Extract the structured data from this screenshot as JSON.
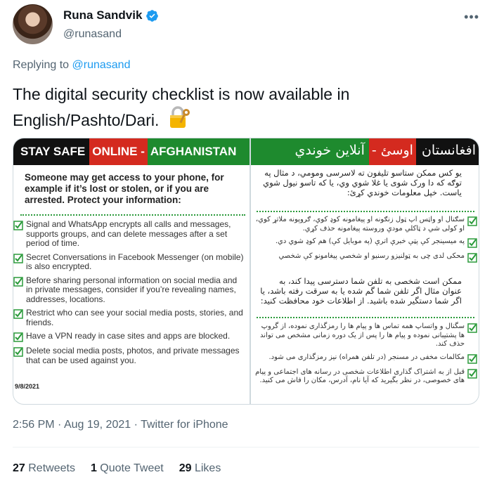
{
  "author": {
    "name": "Runa Sandvik",
    "handle": "@runasand"
  },
  "reply": {
    "prefix": "Replying to ",
    "mention": "@runasand"
  },
  "tweet": {
    "text": "The digital security checklist is now available in English/Pashto/Dari.",
    "emoji_icon": "locked-with-key-icon"
  },
  "media": {
    "left": {
      "banner_part1": "STAY SAFE ",
      "banner_part2": "ONLINE - ",
      "banner_part3": "AFGHANISTAN",
      "intro": "Someone may get access to your phone, for example if it’s lost or stolen, or if you are arrested. Protect your information:",
      "items": [
        "Signal and WhatsApp encrypts all calls and messages, supports groups, and can delete messages after a set period of time.",
        "Secret Conversations in Facebook Messenger (on mobile) is also encrypted.",
        "Before sharing personal information on social media and in private messages, consider if you’re revealing names, addresses, locations.",
        "Restrict who can see your social media posts, stories, and friends.",
        "Have a VPN ready in case sites and apps are blocked.",
        "Delete social media posts, photos, and private messages that can be used against you."
      ],
      "date": "9/8/2021"
    },
    "right": {
      "banner_part1": "آنلاین خوندي",
      "banner_part2": " اوسئ - ",
      "banner_part3": "افغانستان",
      "intro": "یو کس ممکن ستاسو تلیفون ته لاسرسی ومومي، د مثال په توګه که دا ورک شوی یا غلا شوي وي، یا که تاسو نیول شوي یاست. خپل معلومات خوندي کړئ:",
      "items": [
        "سګنال او واټس اپ ټول زنګونه او پیغامونه کوډ کوي، ګروپونه ملاتړ کوي، او کولی شي د ټاکلي مودې وروسته پیغامونه حذف کړي.",
        "په میسینجر کې پټې خبرې اترې (په موبایل کې) هم کوډ شوي دي.",
        "محکی لدی چی به ټولنیزو رسنیو او شخصي پیغامونو کې شخصي"
      ],
      "intro2": "ممکن است شخصی به تلفن شما دسترسی پیدا کند، به عنوان مثال اگر تلفن شما گم شده یا به سرقت رفته باشد، یا اگر شما دستگیر شده باشید. از اطلاعات خود محافظت کنید:",
      "items2": [
        "سگنال و واتساپ همه تماس ها و پیام ها را رمزگذاری نموده، از گروپ ها پشتیبانی نموده و پیام ها را پس از یک دوره زمانی مشخص می تواند حذف کند.",
        "مکالمات مخفی در مسنجر (در تلفن همراه) نیز رمزگذاری می شود.",
        "قبل از به اشتراک گذاری اطلاعات شخصی در رسانه های اجتماعی و پیام های خصوصی، در نظر بگیرید که آیا نام، آدرس، مکان را فاش می کنید."
      ]
    }
  },
  "meta": {
    "time": "2:56 PM",
    "sep": " · ",
    "date": "Aug 19, 2021",
    "source": "Twitter for iPhone"
  },
  "stats": {
    "retweets_count": "27",
    "retweets_label": " Retweets",
    "quotes_count": "1",
    "quotes_label": " Quote Tweet",
    "likes_count": "29",
    "likes_label": " Likes"
  },
  "colors": {
    "link": "#1d9bf0",
    "muted": "#536471",
    "banner_red": "#d42a1f",
    "banner_green": "#1e8a2e",
    "check_green": "#2a9a3a"
  }
}
